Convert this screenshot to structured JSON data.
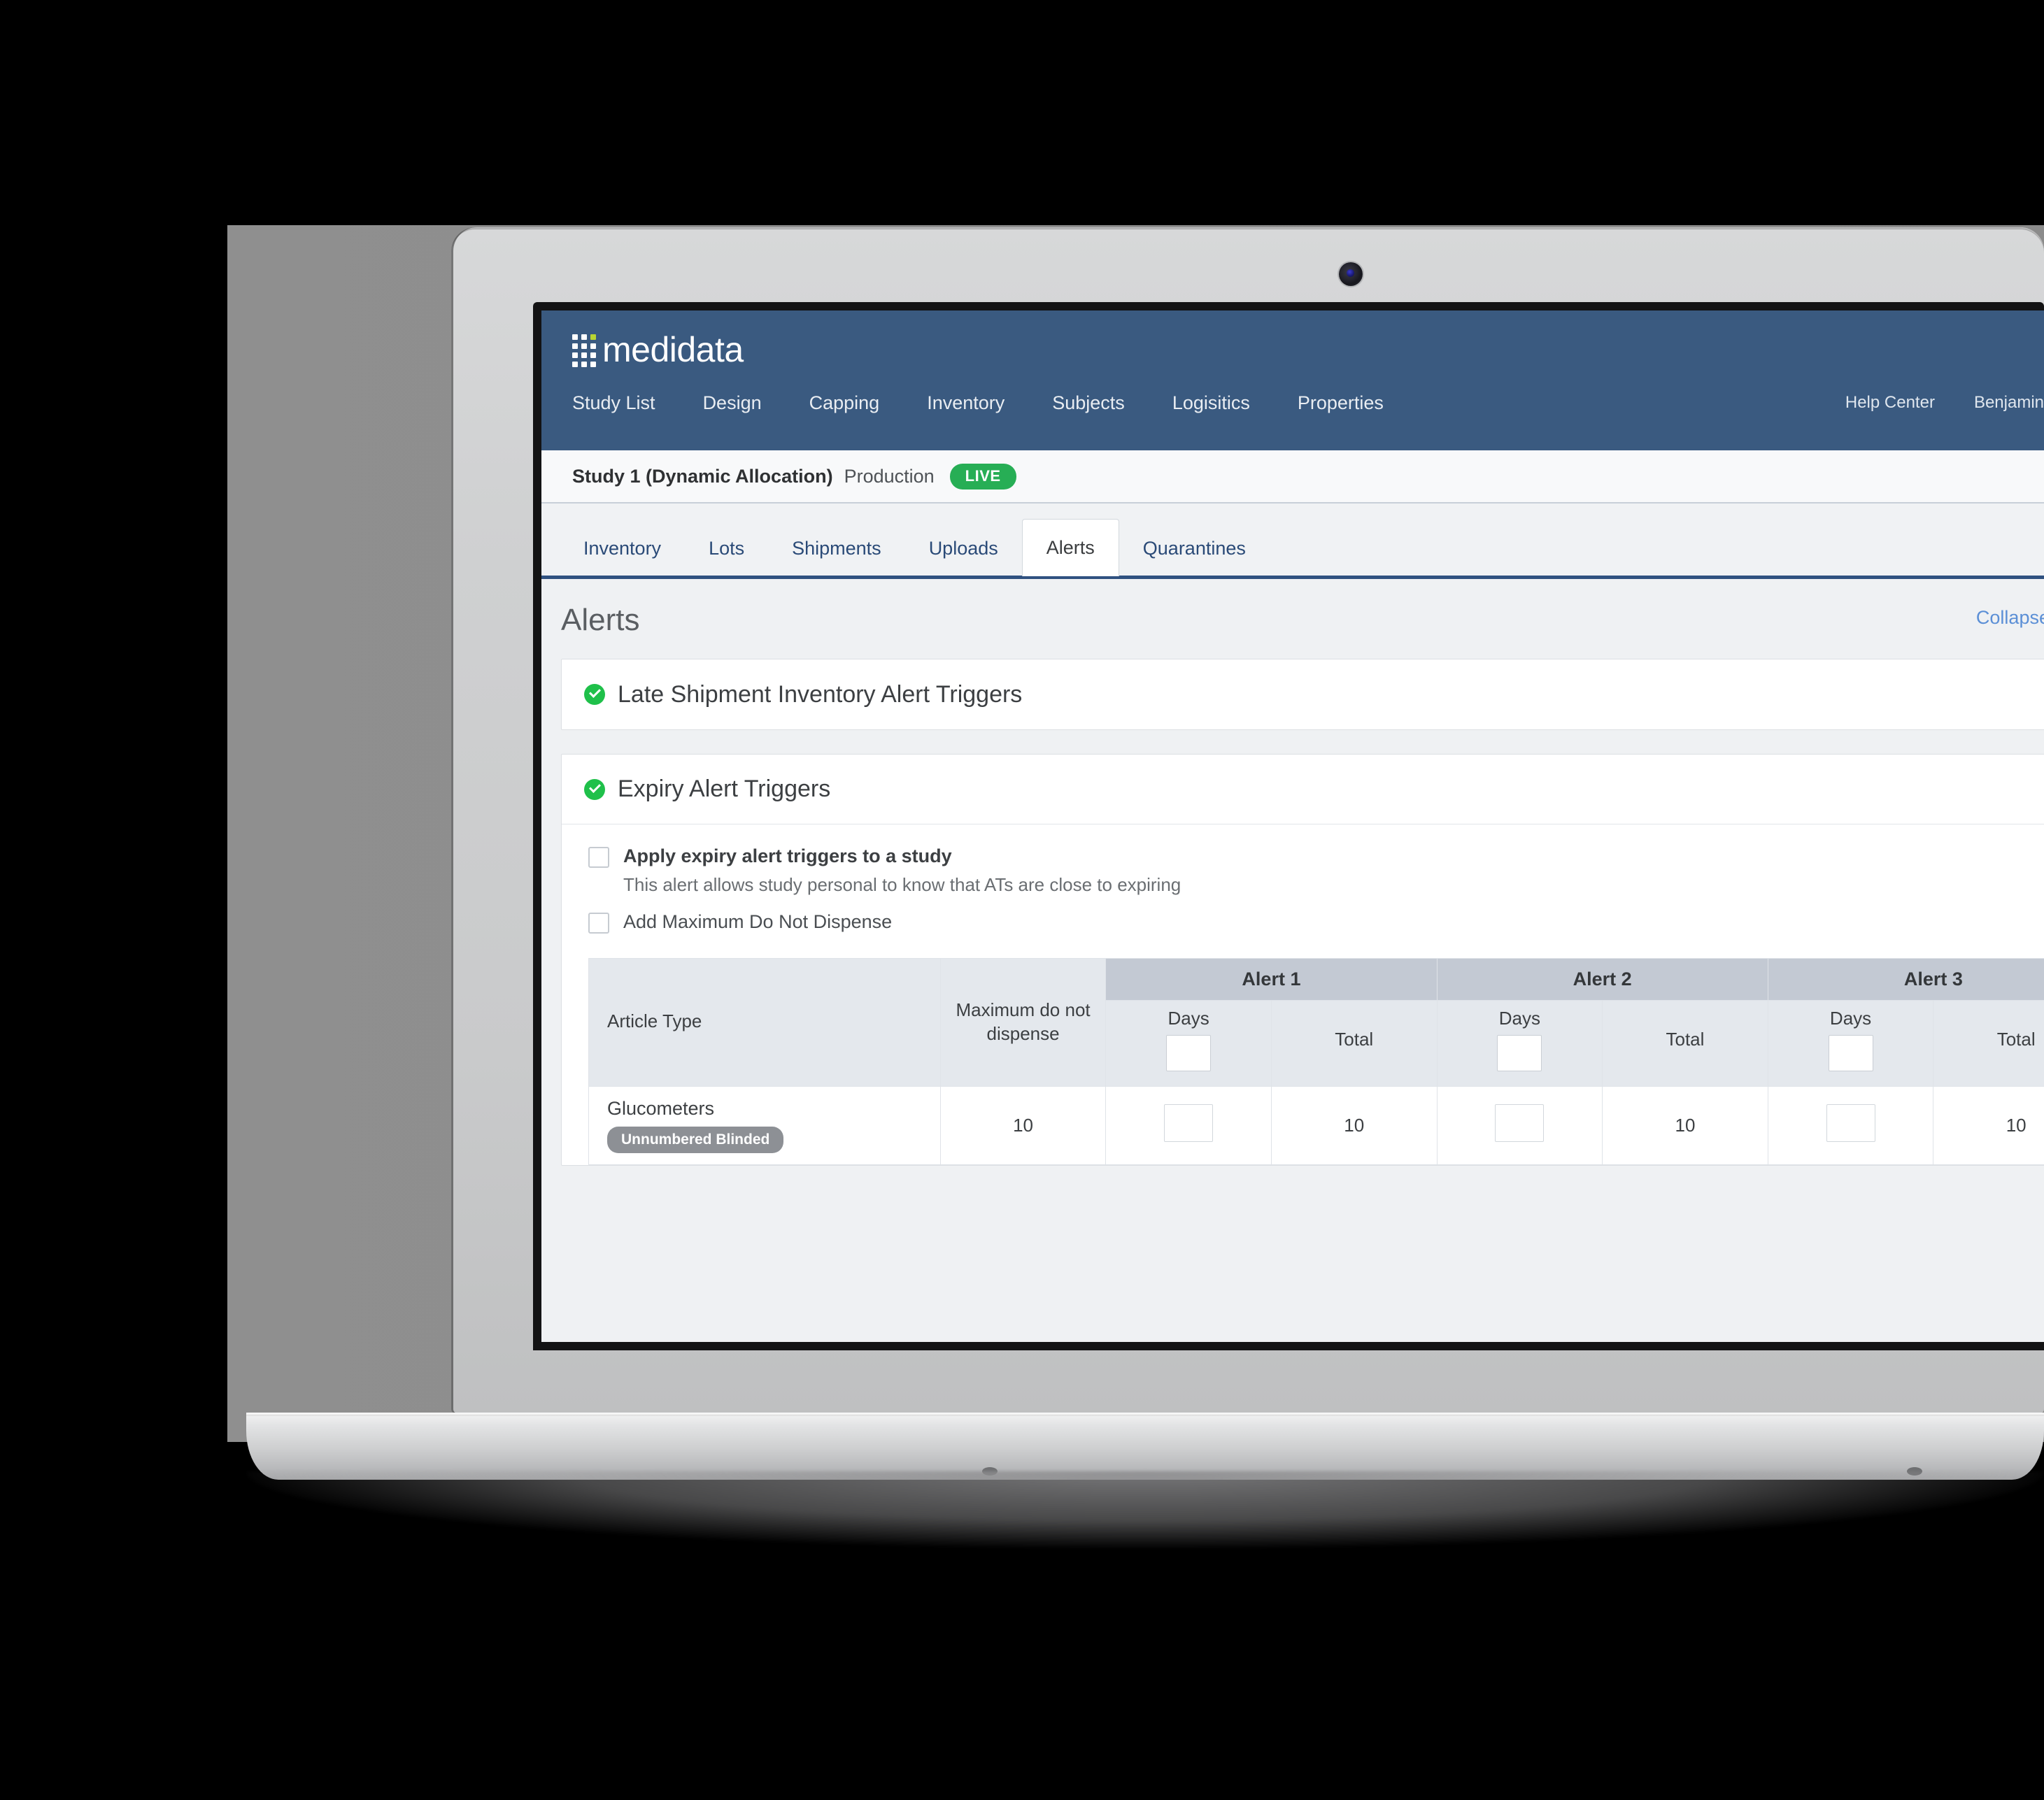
{
  "brand": {
    "name": "medidata",
    "logo_icon": "dot-grid-icon"
  },
  "topnav": {
    "items": [
      {
        "label": "Study List"
      },
      {
        "label": "Design"
      },
      {
        "label": "Capping"
      },
      {
        "label": "Inventory"
      },
      {
        "label": "Subjects"
      },
      {
        "label": "Logisitics"
      },
      {
        "label": "Properties"
      }
    ],
    "right": [
      {
        "label": "Help Center"
      },
      {
        "label": "Benjamin"
      }
    ]
  },
  "studybar": {
    "study_name": "Study 1 (Dynamic Allocation)",
    "environment": "Production",
    "status_badge": "LIVE",
    "badge_color": "#27ae55"
  },
  "tabs": [
    {
      "label": "Inventory",
      "active": false
    },
    {
      "label": "Lots",
      "active": false
    },
    {
      "label": "Shipments",
      "active": false
    },
    {
      "label": "Uploads",
      "active": false
    },
    {
      "label": "Alerts",
      "active": true
    },
    {
      "label": "Quarantines",
      "active": false
    }
  ],
  "page": {
    "title": "Alerts",
    "collapse_link": "Collapse All"
  },
  "cards": [
    {
      "title": "Late Shipment Inventory Alert Triggers",
      "status_icon": "check-circle-icon",
      "status_color": "#1fc04a"
    },
    {
      "title": "Expiry Alert Triggers",
      "status_icon": "check-circle-icon",
      "status_color": "#1fc04a"
    }
  ],
  "expiry": {
    "checkbox_apply": {
      "label": "Apply expiry alert triggers to a study",
      "description": "This alert allows study personal to know that ATs are close to expiring",
      "checked": false
    },
    "checkbox_max_dnd": {
      "label": "Add Maximum Do Not Dispense",
      "checked": false
    },
    "table": {
      "group_headers": [
        "Alert 1",
        "Alert 2",
        "Alert 3"
      ],
      "columns": [
        {
          "label": "Article Type"
        },
        {
          "label": "Maximum do not dispense"
        },
        {
          "label": "Days",
          "has_input": true
        },
        {
          "label": "Total"
        },
        {
          "label": "Days",
          "has_input": true
        },
        {
          "label": "Total"
        },
        {
          "label": "Days",
          "has_input": true
        },
        {
          "label": "Total"
        }
      ],
      "header_inputs": [
        "",
        "",
        ""
      ],
      "rows": [
        {
          "article_type": "Glucometers",
          "badge": "Unnumbered Blinded",
          "max_do_not_dispense": "10",
          "alert1_days": "",
          "alert1_total": "10",
          "alert2_days": "",
          "alert2_total": "10",
          "alert3_days": "",
          "alert3_total": "10"
        }
      ]
    }
  }
}
